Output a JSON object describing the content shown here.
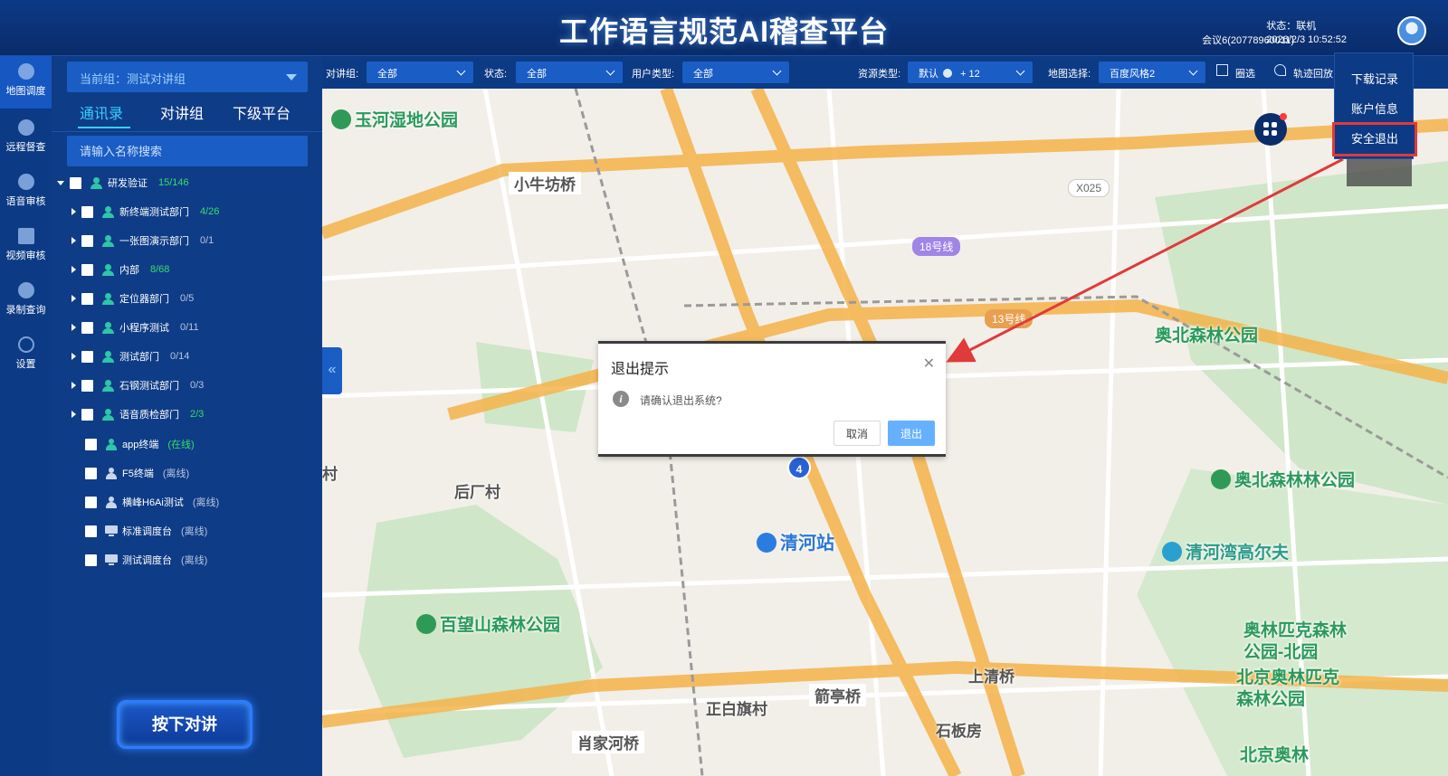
{
  "header": {
    "title": "工作语言规范AI稽查平台",
    "meeting": "会议6(20778960011)",
    "status": "状态：联机",
    "datetime": "2026/2/3 10:52:52"
  },
  "leftnav": {
    "items": [
      {
        "label": "地图调度",
        "icon": "map-pin-icon"
      },
      {
        "label": "远程督查",
        "icon": "eye-icon"
      },
      {
        "label": "语音审核",
        "icon": "voice-icon"
      },
      {
        "label": "视频审核",
        "icon": "video-icon"
      },
      {
        "label": "录制查询",
        "icon": "record-icon"
      },
      {
        "label": "设置",
        "icon": "settings-icon"
      }
    ]
  },
  "sidebar": {
    "current_group": "当前组：测试对讲组",
    "tabs": [
      "通讯录",
      "对讲组",
      "下级平台"
    ],
    "search_placeholder": "请输入名称搜索",
    "root": {
      "name": "研发验证",
      "count": "15/146"
    },
    "groups": [
      {
        "name": "新终端测试部门",
        "count": "4/26",
        "active": true
      },
      {
        "name": "一张图演示部门",
        "count": "0/1",
        "active": false
      },
      {
        "name": "内部",
        "count": "8/68",
        "active": true
      },
      {
        "name": "定位器部门",
        "count": "0/5",
        "active": false
      },
      {
        "name": "小程序测试",
        "count": "0/11",
        "active": false
      },
      {
        "name": "测试部门",
        "count": "0/14",
        "active": false
      },
      {
        "name": "石钢测试部门",
        "count": "0/3",
        "active": false
      },
      {
        "name": "语音质检部门",
        "count": "2/3",
        "active": true
      }
    ],
    "users": [
      {
        "name": "app终端",
        "status": "(在线)",
        "online": true,
        "type": "user"
      },
      {
        "name": "F5终端",
        "status": "(离线)",
        "online": false,
        "type": "user"
      },
      {
        "name": "横峰H6Ai测试",
        "status": "(离线)",
        "online": false,
        "type": "user"
      },
      {
        "name": "标准调度台",
        "status": "(离线)",
        "online": false,
        "type": "pc"
      },
      {
        "name": "测试调度台",
        "status": "(离线)",
        "online": false,
        "type": "pc"
      }
    ],
    "ptt_label": "按下对讲"
  },
  "filters": {
    "talkgroup_label": "对讲组:",
    "talkgroup_value": "全部",
    "status_label": "状态:",
    "status_value": "全部",
    "usertype_label": "用户类型:",
    "usertype_value": "全部",
    "resource_label": "资源类型:",
    "resource_default": "默认",
    "resource_more": "+ 12",
    "mapstyle_label": "地图选择:",
    "mapstyle_value": "百度风格2",
    "circle_label": "圈选",
    "track_label": "轨迹回放"
  },
  "menu": {
    "items": [
      "下载记录",
      "账户信息",
      "安全退出"
    ]
  },
  "dialog": {
    "title": "退出提示",
    "message": "请确认退出系统?",
    "cancel": "取消",
    "confirm": "退出"
  },
  "map": {
    "labels": [
      {
        "text": "玉河湿地公园",
        "kind": "park"
      },
      {
        "text": "小牛坊桥",
        "kind": "road"
      },
      {
        "text": "后厂村",
        "kind": "road"
      },
      {
        "text": "清河站",
        "kind": "station"
      },
      {
        "text": "百望山森林公园",
        "kind": "park"
      },
      {
        "text": "正白旗村",
        "kind": "road"
      },
      {
        "text": "箭亭桥",
        "kind": "road"
      },
      {
        "text": "肖家河桥",
        "kind": "road"
      },
      {
        "text": "上清桥",
        "kind": "road"
      },
      {
        "text": "石板房",
        "kind": "road"
      },
      {
        "text": "奥北森林公园",
        "kind": "park"
      },
      {
        "text": "奥北森林林公园",
        "kind": "park"
      },
      {
        "text": "清河湾高尔夫",
        "kind": "golf"
      },
      {
        "text": "奥林匹克森林",
        "kind": "park"
      },
      {
        "text": "公园-北园",
        "kind": "park"
      },
      {
        "text": "北京奥林匹克",
        "kind": "park"
      },
      {
        "text": "森林公园",
        "kind": "park"
      },
      {
        "text": "北京奥林",
        "kind": "park"
      },
      {
        "text": "X025",
        "kind": "road"
      },
      {
        "text": "18号线",
        "kind": "metro"
      },
      {
        "text": "13号线",
        "kind": "metro"
      },
      {
        "text": "村",
        "kind": "road"
      }
    ],
    "cluster_count": "4"
  },
  "colors": {
    "accent": "#35d0ff",
    "header_bg": "#0d3a86",
    "panel_bg": "#0f3c87",
    "confirm_btn": "#66b1ff",
    "highlight": "#e03a3a",
    "online": "#2fe06a"
  }
}
